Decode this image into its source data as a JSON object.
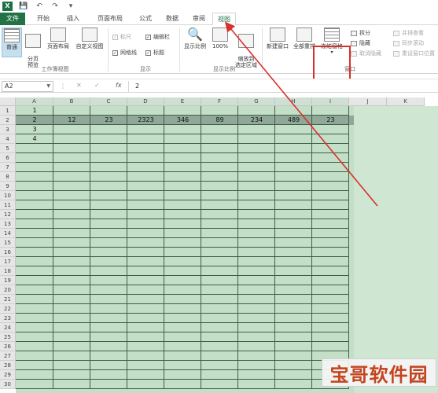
{
  "titlebar": {
    "app_logo": "X",
    "qat": [
      "save-icon",
      "undo-icon",
      "redo-icon",
      "customize-icon"
    ]
  },
  "tabs": [
    {
      "label": "文件",
      "key": "file"
    },
    {
      "label": "开始",
      "key": "home"
    },
    {
      "label": "插入",
      "key": "insert"
    },
    {
      "label": "页面布局",
      "key": "page-layout"
    },
    {
      "label": "公式",
      "key": "formulas"
    },
    {
      "label": "数据",
      "key": "data"
    },
    {
      "label": "审阅",
      "key": "review"
    },
    {
      "label": "视图",
      "key": "view"
    }
  ],
  "ribbon": {
    "workbook_views": {
      "label": "工作簿视图",
      "normal": "普通",
      "page_break": "分页\n预览",
      "page_layout": "页面布局",
      "custom_view": "自定义视图"
    },
    "show": {
      "label": "显示",
      "ruler": "标尺",
      "formula_bar": "编辑栏",
      "gridlines": "网格线",
      "headings": "标题"
    },
    "zoom": {
      "label": "显示比例",
      "zoom": "显示比例",
      "hundred": "100%",
      "zoom_selection": "缩放到\n选定区域"
    },
    "window": {
      "label": "窗口",
      "new_window": "新建窗口",
      "arrange_all": "全部重排",
      "freeze_panes": "冻结窗格",
      "split": "拆分",
      "hide": "隐藏",
      "unhide": "取消隐藏",
      "side_by_side": "并排查看",
      "sync_scroll": "同步滚动",
      "reset_position": "重设窗口位置"
    }
  },
  "formula_bar": {
    "name_box": "A2",
    "cancel": "✕",
    "enter": "✓",
    "fx": "fx",
    "value": "2"
  },
  "sheet": {
    "columns": [
      "A",
      "B",
      "C",
      "D",
      "E",
      "F",
      "G",
      "H",
      "I",
      "J",
      "K"
    ],
    "rows": [
      "1",
      "2",
      "3",
      "4",
      "5",
      "6",
      "7",
      "8",
      "9",
      "10",
      "11",
      "12",
      "13",
      "14",
      "15",
      "16",
      "17",
      "18",
      "19",
      "20",
      "21",
      "22",
      "23",
      "24",
      "25",
      "26",
      "27",
      "28",
      "29",
      "30"
    ],
    "cells": {
      "A1": "1",
      "A2": "2",
      "A3": "3",
      "A4": "4",
      "B2": "12",
      "C2": "23",
      "D2": "2323",
      "E2": "346",
      "F2": "89",
      "G2": "234",
      "H2": "489",
      "I2": "23"
    }
  },
  "watermark": "宝哥软件园",
  "colors": {
    "excel_green": "#217346",
    "highlight_red": "#d9302c",
    "grid_fill": "#c4dfc7",
    "gridline": "#3f5e47"
  }
}
